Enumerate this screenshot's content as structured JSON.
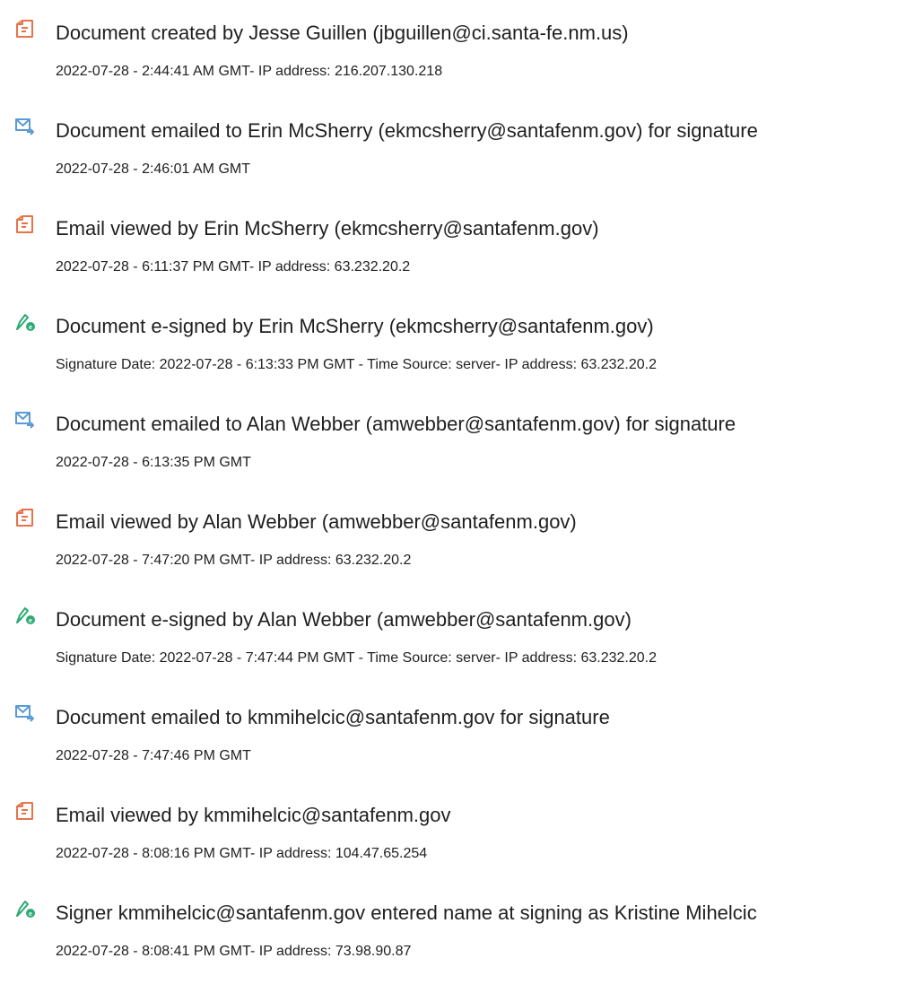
{
  "entries": [
    {
      "icon": "document-icon",
      "title": "Document created by Jesse Guillen (jbguillen@ci.santa-fe.nm.us)",
      "detail": "2022-07-28 - 2:44:41 AM GMT- IP address: 216.207.130.218"
    },
    {
      "icon": "email-sent-icon",
      "title": "Document emailed to Erin McSherry (ekmcsherry@santafenm.gov) for signature",
      "detail": "2022-07-28 - 2:46:01 AM GMT"
    },
    {
      "icon": "document-icon",
      "title": "Email viewed by Erin McSherry (ekmcsherry@santafenm.gov)",
      "detail": "2022-07-28 - 6:11:37 PM GMT- IP address: 63.232.20.2"
    },
    {
      "icon": "e-sign-pen-icon",
      "title": "Document e-signed by Erin McSherry (ekmcsherry@santafenm.gov)",
      "detail": "Signature Date: 2022-07-28 - 6:13:33 PM GMT - Time Source: server- IP address: 63.232.20.2"
    },
    {
      "icon": "email-sent-icon",
      "title": "Document emailed to Alan Webber (amwebber@santafenm.gov) for signature",
      "detail": "2022-07-28 - 6:13:35 PM GMT"
    },
    {
      "icon": "document-icon",
      "title": "Email viewed by Alan Webber (amwebber@santafenm.gov)",
      "detail": "2022-07-28 - 7:47:20 PM GMT- IP address: 63.232.20.2"
    },
    {
      "icon": "e-sign-pen-icon",
      "title": "Document e-signed by Alan Webber (amwebber@santafenm.gov)",
      "detail": "Signature Date: 2022-07-28 - 7:47:44 PM GMT - Time Source: server- IP address: 63.232.20.2"
    },
    {
      "icon": "email-sent-icon",
      "title": "Document emailed to kmmihelcic@santafenm.gov for signature",
      "detail": "2022-07-28 - 7:47:46 PM GMT"
    },
    {
      "icon": "document-icon",
      "title": "Email viewed by kmmihelcic@santafenm.gov",
      "detail": "2022-07-28 - 8:08:16 PM GMT- IP address: 104.47.65.254"
    },
    {
      "icon": "e-sign-pen-icon",
      "title": "Signer kmmihelcic@santafenm.gov entered name at signing as Kristine Mihelcic",
      "detail": "2022-07-28 - 8:08:41 PM GMT- IP address: 73.98.90.87"
    }
  ],
  "colors": {
    "document_icon": "#e8734a",
    "email_icon": "#5b9bd5",
    "sign_icon": "#2dab74"
  }
}
